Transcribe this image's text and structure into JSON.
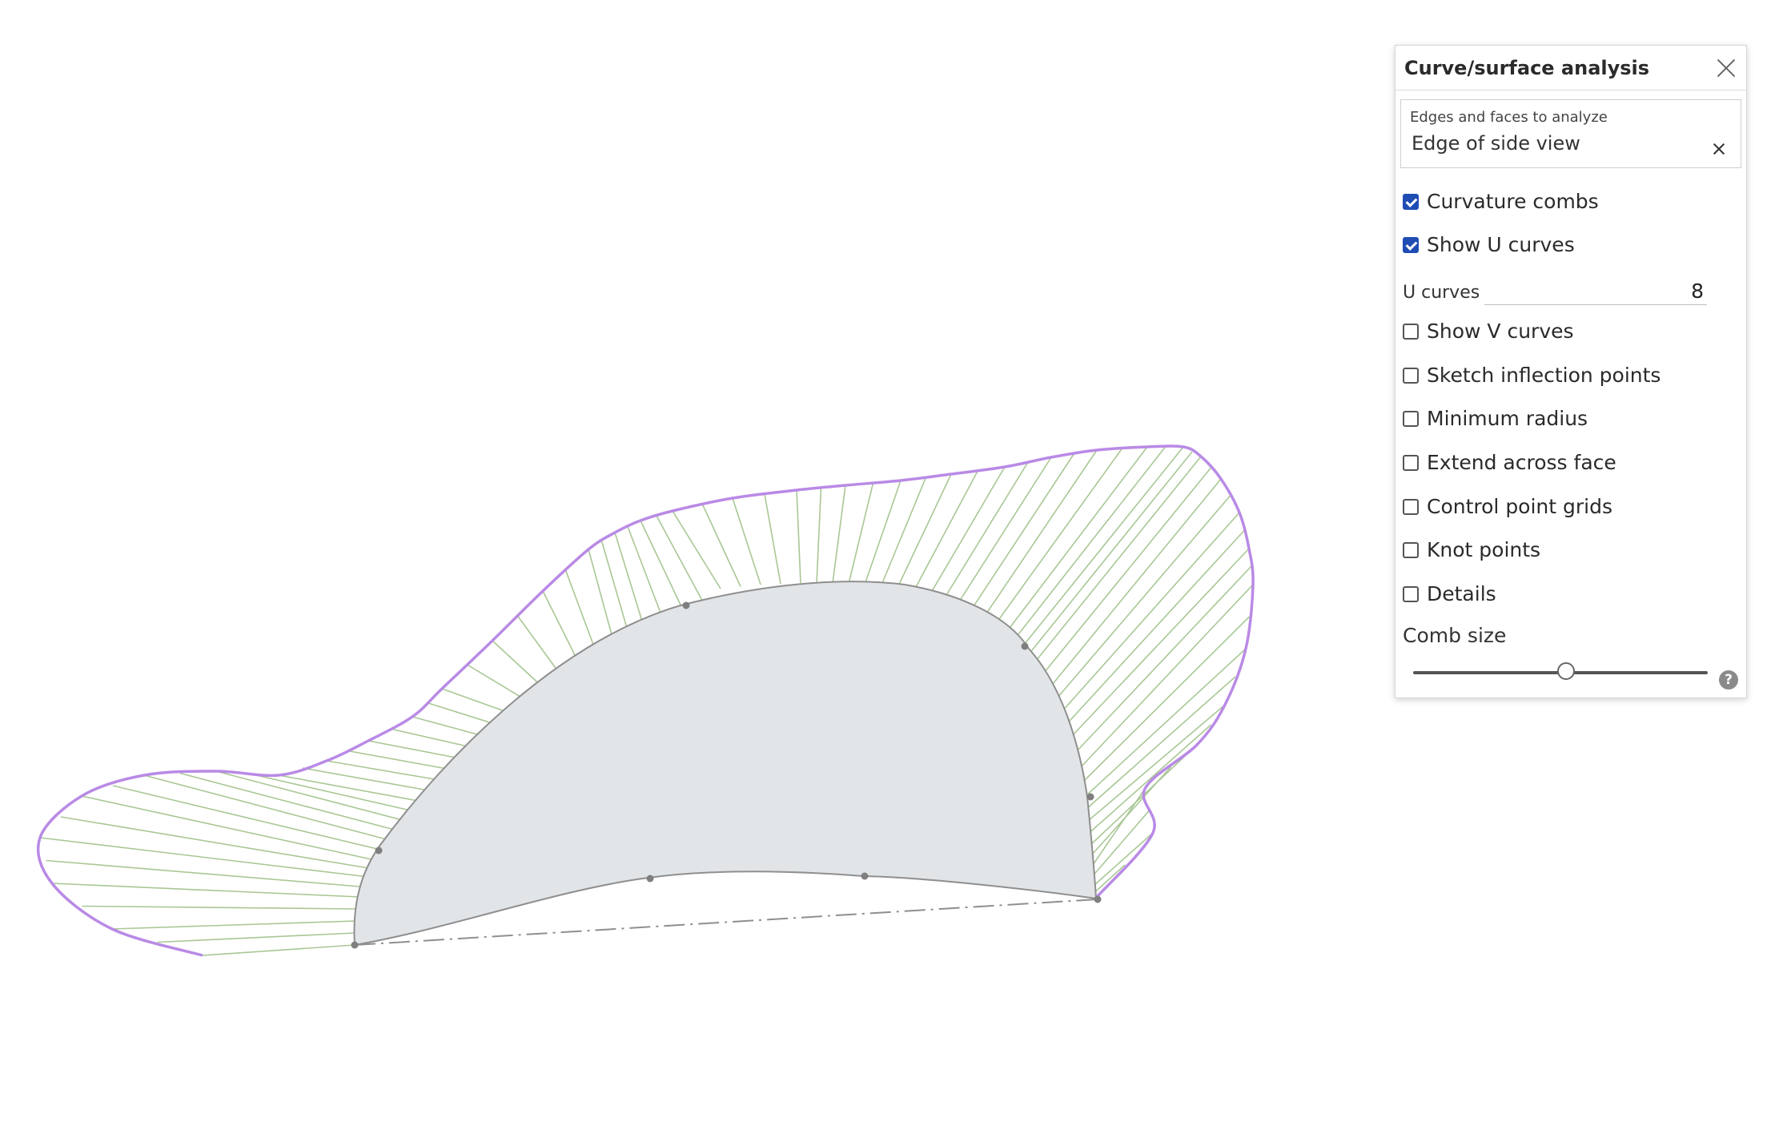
{
  "panel": {
    "title": "Curve/surface analysis",
    "selection_field": {
      "label": "Edges and faces to analyze",
      "value": "Edge of side view"
    },
    "options": [
      {
        "label": "Curvature combs",
        "checked": true
      },
      {
        "label": "Show U curves",
        "checked": true
      },
      {
        "label": "Show V curves",
        "checked": false
      },
      {
        "label": "Sketch inflection points",
        "checked": false
      },
      {
        "label": "Minimum radius",
        "checked": false
      },
      {
        "label": "Extend across face",
        "checked": false
      },
      {
        "label": "Control point grids",
        "checked": false
      },
      {
        "label": "Knot points",
        "checked": false
      },
      {
        "label": "Details",
        "checked": false
      }
    ],
    "u_curves": {
      "label": "U curves",
      "value": "8"
    },
    "comb_size": {
      "label": "Comb size",
      "fraction": 0.52
    },
    "help_glyph": "?"
  },
  "colors": {
    "comb_envelope": "#b98ae6",
    "comb_teeth": "#a9c795",
    "shape_fill": "#e2e5e8",
    "shape_edge": "#8f8f8f",
    "checkbox_accent": "#1f4db4"
  },
  "icons": {
    "close": "close-icon",
    "clear": "clear-icon",
    "help": "help-icon"
  }
}
